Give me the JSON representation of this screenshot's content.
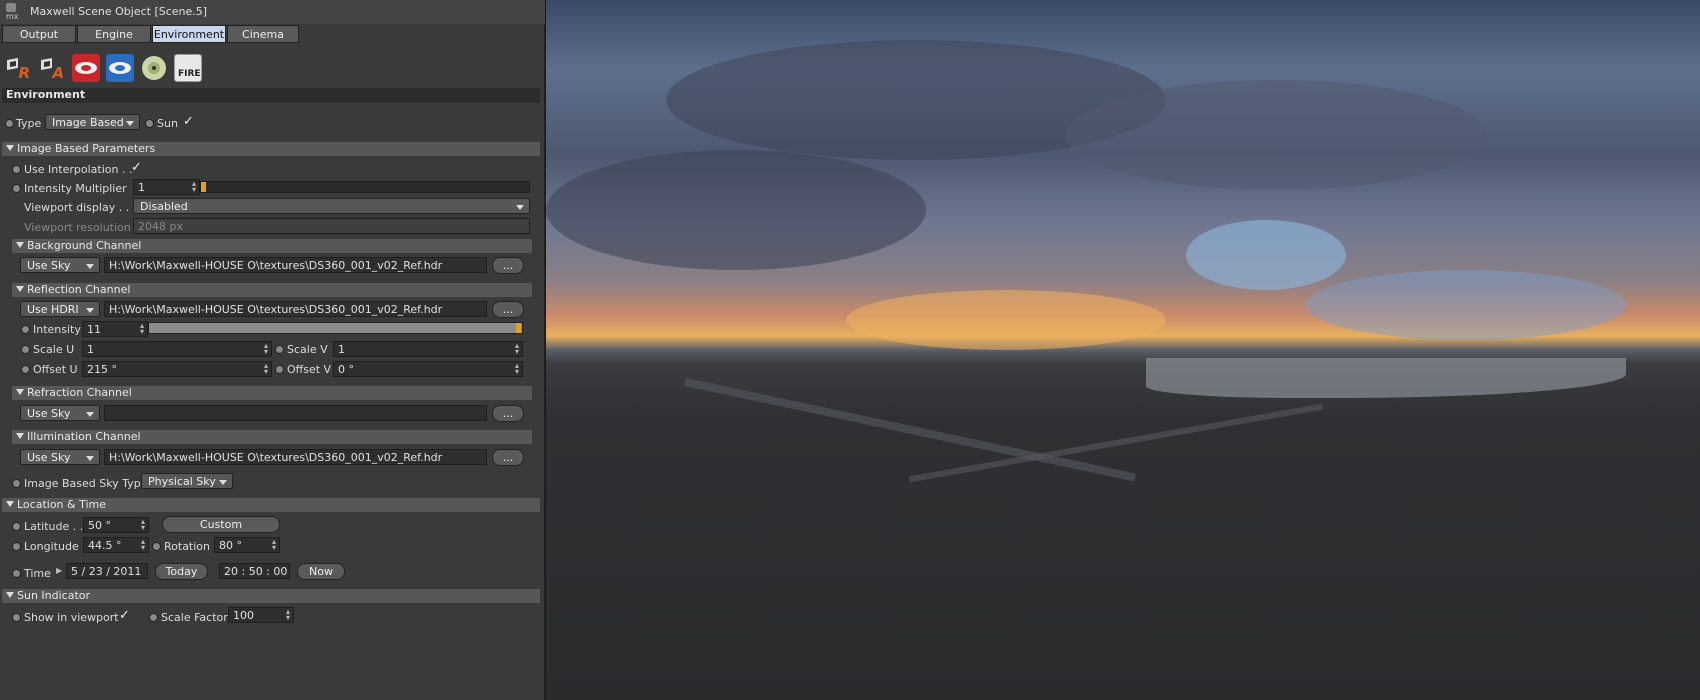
{
  "window": {
    "title": "Maxwell Scene Object [Scene.5]",
    "logo_text": "mx"
  },
  "tabs": [
    "Output",
    "Engine",
    "Environment",
    "Cinema"
  ],
  "active_tab": "Environment",
  "toolbar_icons": [
    "render-icon",
    "alpha-icon",
    "red-disc-icon",
    "blue-disc-icon",
    "cd-icon",
    "fire-icon"
  ],
  "fire_label": "FIRE",
  "icon_letters": {
    "render": "R",
    "alpha": "A"
  },
  "environment": {
    "heading": "Environment",
    "type_label": "Type",
    "type_value": "Image Based",
    "sun_label": "Sun",
    "sun_check": "✓"
  },
  "ibp": {
    "heading": "Image Based Parameters",
    "use_interp_label": "Use Interpolation . .",
    "use_interp_check": "✓",
    "intensity_mult_label": "Intensity Multiplier",
    "intensity_mult_value": "1",
    "intensity_mult_level": 0.0,
    "viewport_display_label": "Viewport display . . .",
    "viewport_display_value": "Disabled",
    "viewport_res_label": "Viewport resolution",
    "viewport_res_value": "2048 px"
  },
  "background": {
    "heading": "Background Channel",
    "mode": "Use Sky",
    "path": "H:\\Work\\Maxwell-HOUSE O\\textures\\DS360_001_v02_Ref.hdr",
    "browse": "..."
  },
  "reflection": {
    "heading": "Reflection Channel",
    "mode": "Use HDRI",
    "path": "H:\\Work\\Maxwell-HOUSE O\\textures\\DS360_001_v02_Ref.hdr",
    "browse": "...",
    "intensity_label": "Intensity",
    "intensity_value": "11",
    "intensity_level": 1.0,
    "scale_u_label": "Scale U",
    "scale_u_value": "1",
    "scale_v_label": "Scale V",
    "scale_v_value": "1",
    "offset_u_label": "Offset U",
    "offset_u_value": "215 °",
    "offset_v_label": "Offset V",
    "offset_v_value": "0 °"
  },
  "refraction": {
    "heading": "Refraction Channel",
    "mode": "Use Sky",
    "path": "",
    "browse": "..."
  },
  "illumination": {
    "heading": "Illumination Channel",
    "mode": "Use Sky",
    "path": "H:\\Work\\Maxwell-HOUSE O\\textures\\DS360_001_v02_Ref.hdr",
    "browse": "..."
  },
  "ib_sky_type": {
    "label": "Image Based Sky Type",
    "value": "Physical Sky"
  },
  "location": {
    "heading": "Location & Time",
    "latitude_label": "Latitude . .",
    "latitude_value": "50 °",
    "custom_button": "Custom",
    "longitude_label": "Longitude",
    "longitude_value": "44.5 °",
    "rotation_label": "Rotation",
    "rotation_value": "80 °",
    "time_label": "Time",
    "date_value": "5 / 23 / 2011",
    "today_button": "Today",
    "time_value": "20 : 50 : 00",
    "now_button": "Now"
  },
  "sun_indicator": {
    "heading": "Sun Indicator",
    "show_label": "Show in viewport",
    "show_check": "✓",
    "scale_label": "Scale Factor",
    "scale_value": "100"
  }
}
